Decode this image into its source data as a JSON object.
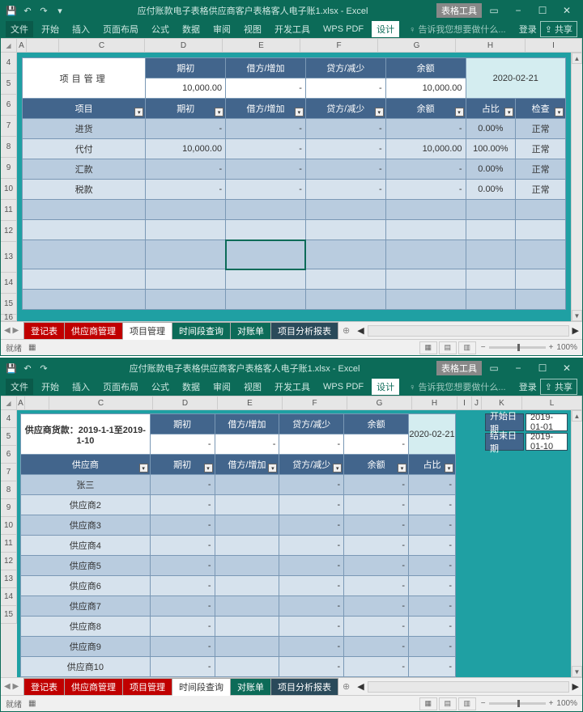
{
  "top": {
    "title": "应付账款电子表格供应商客户表格客人电子账1.xlsx - Excel",
    "context_tab": "表格工具",
    "ribbon_tabs": [
      "文件",
      "开始",
      "插入",
      "页面布局",
      "公式",
      "数据",
      "审阅",
      "视图",
      "开发工具",
      "WPS PDF",
      "设计"
    ],
    "tell_me": "告诉我您想要做什么...",
    "login": "登录",
    "share": "共享",
    "cols": [
      "A",
      "B",
      "C",
      "D",
      "E",
      "F",
      "G",
      "H",
      "I"
    ],
    "rows": [
      "4",
      "5",
      "6",
      "7",
      "8",
      "9",
      "10",
      "11",
      "12",
      "13",
      "14",
      "15",
      "16"
    ],
    "sheet": {
      "title": "项目管理",
      "date": "2020-02-21",
      "sum_headers": [
        "期初",
        "借方/增加",
        "贷方/减少",
        "余额"
      ],
      "sum_values": [
        "10,000.00",
        "-",
        "-",
        "10,000.00"
      ],
      "col_headers": [
        "项目",
        "期初",
        "借方/增加",
        "贷方/减少",
        "余额",
        "占比",
        "检查"
      ],
      "rows": [
        {
          "name": "进货",
          "qc": "-",
          "jf": "-",
          "df": "-",
          "ye": "-",
          "zb": "0.00%",
          "jc": "正常"
        },
        {
          "name": "代付",
          "qc": "10,000.00",
          "jf": "-",
          "df": "-",
          "ye": "10,000.00",
          "zb": "100.00%",
          "jc": "正常"
        },
        {
          "name": "汇款",
          "qc": "-",
          "jf": "-",
          "df": "-",
          "ye": "-",
          "zb": "0.00%",
          "jc": "正常"
        },
        {
          "name": "税款",
          "qc": "-",
          "jf": "-",
          "df": "-",
          "ye": "-",
          "zb": "0.00%",
          "jc": "正常"
        },
        {
          "name": "",
          "qc": "",
          "jf": "",
          "df": "",
          "ye": "",
          "zb": "",
          "jc": ""
        },
        {
          "name": "",
          "qc": "",
          "jf": "",
          "df": "",
          "ye": "",
          "zb": "",
          "jc": ""
        },
        {
          "name": "",
          "qc": "",
          "jf": "",
          "df": "",
          "ye": "",
          "zb": "",
          "jc": ""
        },
        {
          "name": "",
          "qc": "",
          "jf": "",
          "df": "",
          "ye": "",
          "zb": "",
          "jc": ""
        },
        {
          "name": "",
          "qc": "",
          "jf": "",
          "df": "",
          "ye": "",
          "zb": "",
          "jc": ""
        }
      ]
    },
    "sheet_tabs": [
      "登记表",
      "供应商管理",
      "项目管理",
      "时间段查询",
      "对账单",
      "项目分析报表"
    ],
    "active_tab": "项目管理",
    "status": "就绪",
    "zoom": "100%"
  },
  "bot": {
    "title": "应付账款电子表格供应商客户表格客人电子账1.xlsx - Excel",
    "context_tab": "表格工具",
    "ribbon_tabs": [
      "文件",
      "开始",
      "插入",
      "页面布局",
      "公式",
      "数据",
      "审阅",
      "视图",
      "开发工具",
      "WPS PDF",
      "设计"
    ],
    "tell_me": "告诉我您想要做什么...",
    "login": "登录",
    "share": "共享",
    "cols": [
      "A",
      "B",
      "C",
      "D",
      "E",
      "F",
      "G",
      "H",
      "I",
      "J",
      "K",
      "L"
    ],
    "rows": [
      "4",
      "5",
      "6",
      "7",
      "8",
      "9",
      "10",
      "11",
      "12",
      "13",
      "14",
      "15"
    ],
    "sheet": {
      "title": "供应商货款：2019-1-1至2019-1-10",
      "date": "2020-02-21",
      "sum_headers": [
        "期初",
        "借方/增加",
        "贷方/减少",
        "余额"
      ],
      "sum_values": [
        "-",
        "-",
        "-",
        "-"
      ],
      "col_headers": [
        "供应商",
        "期初",
        "借方/增加",
        "贷方/减少",
        "余额",
        "占比"
      ],
      "side": {
        "start_lbl": "开始日期",
        "start_val": "2019-01-01",
        "end_lbl": "结束日期",
        "end_val": "2019-01-10"
      },
      "rows": [
        {
          "name": "张三",
          "qc": "-",
          "jf": "",
          "df": "-",
          "ye": "-",
          "zb": "-"
        },
        {
          "name": "供应商2",
          "qc": "-",
          "jf": "",
          "df": "-",
          "ye": "-",
          "zb": "-"
        },
        {
          "name": "供应商3",
          "qc": "-",
          "jf": "",
          "df": "-",
          "ye": "-",
          "zb": "-"
        },
        {
          "name": "供应商4",
          "qc": "-",
          "jf": "",
          "df": "-",
          "ye": "-",
          "zb": "-"
        },
        {
          "name": "供应商5",
          "qc": "-",
          "jf": "",
          "df": "-",
          "ye": "-",
          "zb": "-"
        },
        {
          "name": "供应商6",
          "qc": "-",
          "jf": "",
          "df": "-",
          "ye": "-",
          "zb": "-"
        },
        {
          "name": "供应商7",
          "qc": "-",
          "jf": "",
          "df": "-",
          "ye": "-",
          "zb": "-"
        },
        {
          "name": "供应商8",
          "qc": "-",
          "jf": "",
          "df": "-",
          "ye": "-",
          "zb": "-"
        },
        {
          "name": "供应商9",
          "qc": "-",
          "jf": "",
          "df": "-",
          "ye": "-",
          "zb": "-"
        },
        {
          "name": "供应商10",
          "qc": "-",
          "jf": "",
          "df": "-",
          "ye": "-",
          "zb": "-"
        }
      ]
    },
    "sheet_tabs": [
      "登记表",
      "供应商管理",
      "项目管理",
      "时间段查询",
      "对账单",
      "项目分析报表"
    ],
    "active_tab": "时间段查询",
    "status": "就绪",
    "zoom": "100%"
  }
}
